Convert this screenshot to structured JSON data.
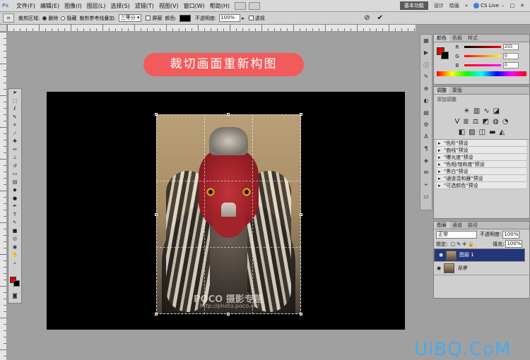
{
  "app": {
    "logo": "Ps"
  },
  "menu": {
    "items": [
      "文件(F)",
      "编辑(E)",
      "图像(I)",
      "图层(L)",
      "选择(S)",
      "滤镜(T)",
      "视图(V)",
      "窗口(W)",
      "帮助(H)"
    ]
  },
  "workspace": {
    "active": "基本功能",
    "items": [
      "设计",
      "绘画"
    ],
    "cslive": "CS Live"
  },
  "options": {
    "crop_area_label": "裁剪区域:",
    "delete": "删除",
    "hide": "隐藏",
    "overlay_label": "裁剪参考线叠加:",
    "overlay_value": "三等分",
    "shield": "屏蔽",
    "color_label": "颜色:",
    "opacity_label": "不透明度:",
    "opacity_value": "100%",
    "perspective": "透视"
  },
  "banner": {
    "text": "裁切画面重新构图"
  },
  "watermark": {
    "line1": "POCO 摄影专题",
    "line2": "http://photo.poco.cn/"
  },
  "brand": {
    "text": "UiBQ.CoM"
  },
  "color_panel": {
    "tabs": [
      "颜色",
      "色板",
      "样式"
    ],
    "sliders": [
      {
        "label": "R",
        "value": "255"
      },
      {
        "label": "G",
        "value": "0"
      },
      {
        "label": "B",
        "value": "0"
      }
    ]
  },
  "adjust_panel": {
    "tabs": [
      "调整",
      "蒙版"
    ],
    "title": "添加调整",
    "presets": [
      "\"色阶\"预设",
      "\"曲线\"预设",
      "\"曝光度\"预设",
      "\"色相/饱和度\"预设",
      "\"黑白\"预设",
      "\"通道混和器\"预设",
      "\"可选颜色\"预设"
    ]
  },
  "layers_panel": {
    "tabs": [
      "图层",
      "通道",
      "路径"
    ],
    "blend_mode": "正常",
    "opacity_label": "不透明度:",
    "opacity_value": "100%",
    "lock_label": "锁定:",
    "fill_label": "填充:",
    "fill_value": "100%",
    "layers": [
      {
        "name": "图层 1",
        "selected": true
      },
      {
        "name": "背景",
        "selected": false
      }
    ]
  },
  "colors": {
    "banner": "#f15b5b",
    "foreground": "#e00000",
    "background": "#000000",
    "selected_layer": "#24367a",
    "brand": "#4aa8ef"
  }
}
